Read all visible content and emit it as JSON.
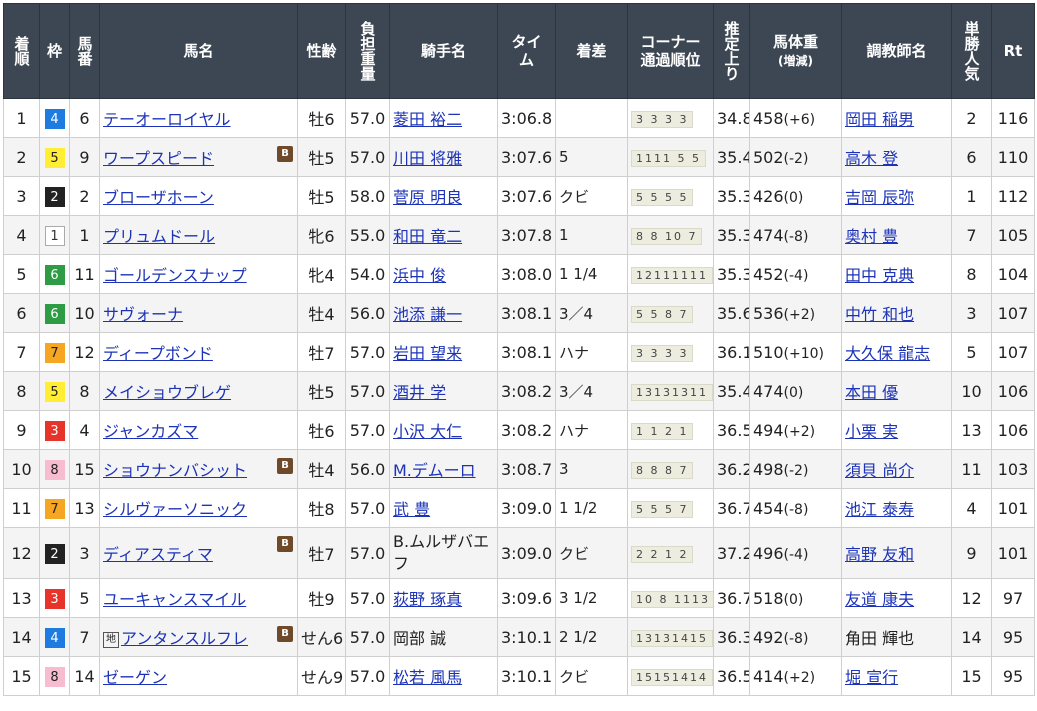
{
  "headers": {
    "rank": "着順",
    "waku": "枠",
    "num": "馬番",
    "horse": "馬名",
    "sexage": "性齢",
    "weight": "負担重量",
    "jockey": "騎手名",
    "time": "タイム",
    "margin": "着差",
    "corner": "コーナー通過順位",
    "last3f": "推定上り",
    "body": "馬体重",
    "body_sub": "(増減)",
    "trainer": "調教師名",
    "pop": "単勝人気",
    "rt": "Rt"
  },
  "blinker_label": "B",
  "rows": [
    {
      "rank": "1",
      "waku": "4",
      "num": "6",
      "horse": "テーオーロイヤル",
      "b": false,
      "sexage": "牡6",
      "weight": "57.0",
      "jockey": "菱田 裕二",
      "jlink": true,
      "time": "3:06.8",
      "margin": "",
      "corner": "3 3 3 3",
      "last3f": "34.8",
      "body": "458",
      "diff": "(+6)",
      "trainer": "岡田 稲男",
      "tlink": true,
      "pop": "2",
      "rt": "116"
    },
    {
      "rank": "2",
      "waku": "5",
      "num": "9",
      "horse": "ワープスピード",
      "b": true,
      "sexage": "牡5",
      "weight": "57.0",
      "jockey": "川田 将雅",
      "jlink": true,
      "time": "3:07.6",
      "margin": "5",
      "corner": "1111 5 5",
      "last3f": "35.4",
      "body": "502",
      "diff": "(-2)",
      "trainer": "高木 登",
      "tlink": true,
      "pop": "6",
      "rt": "110"
    },
    {
      "rank": "3",
      "waku": "2",
      "num": "2",
      "horse": "ブローザホーン",
      "b": false,
      "sexage": "牡5",
      "weight": "58.0",
      "jockey": "菅原 明良",
      "jlink": true,
      "time": "3:07.6",
      "margin": "クビ",
      "corner": "5 5 5 5",
      "last3f": "35.3",
      "body": "426",
      "diff": "(0)",
      "trainer": "吉岡 辰弥",
      "tlink": true,
      "pop": "1",
      "rt": "112"
    },
    {
      "rank": "4",
      "waku": "1",
      "num": "1",
      "horse": "プリュムドール",
      "b": false,
      "sexage": "牝6",
      "weight": "55.0",
      "jockey": "和田 竜二",
      "jlink": true,
      "time": "3:07.8",
      "margin": "1",
      "corner": "8 8 10 7",
      "last3f": "35.3",
      "body": "474",
      "diff": "(-8)",
      "trainer": "奥村 豊",
      "tlink": true,
      "pop": "7",
      "rt": "105"
    },
    {
      "rank": "5",
      "waku": "6",
      "num": "11",
      "horse": "ゴールデンスナップ",
      "b": false,
      "sexage": "牝4",
      "weight": "54.0",
      "jockey": "浜中 俊",
      "jlink": true,
      "time": "3:08.0",
      "margin": "1 1/4",
      "corner": "12111111",
      "last3f": "35.3",
      "body": "452",
      "diff": "(-4)",
      "trainer": "田中 克典",
      "tlink": true,
      "pop": "8",
      "rt": "104"
    },
    {
      "rank": "6",
      "waku": "6",
      "num": "10",
      "horse": "サヴォーナ",
      "b": false,
      "sexage": "牡4",
      "weight": "56.0",
      "jockey": "池添 謙一",
      "jlink": true,
      "time": "3:08.1",
      "margin": "3／4",
      "corner": "5 5 8 7",
      "last3f": "35.6",
      "body": "536",
      "diff": "(+2)",
      "trainer": "中竹 和也",
      "tlink": true,
      "pop": "3",
      "rt": "107"
    },
    {
      "rank": "7",
      "waku": "7",
      "num": "12",
      "horse": "ディープボンド",
      "b": false,
      "sexage": "牡7",
      "weight": "57.0",
      "jockey": "岩田 望来",
      "jlink": true,
      "time": "3:08.1",
      "margin": "ハナ",
      "corner": "3 3 3 3",
      "last3f": "36.1",
      "body": "510",
      "diff": "(+10)",
      "trainer": "大久保 龍志",
      "tlink": true,
      "pop": "5",
      "rt": "107"
    },
    {
      "rank": "8",
      "waku": "5",
      "num": "8",
      "horse": "メイショウブレゲ",
      "b": false,
      "sexage": "牡5",
      "weight": "57.0",
      "jockey": "酒井 学",
      "jlink": true,
      "time": "3:08.2",
      "margin": "3／4",
      "corner": "13131311",
      "last3f": "35.4",
      "body": "474",
      "diff": "(0)",
      "trainer": "本田 優",
      "tlink": true,
      "pop": "10",
      "rt": "106"
    },
    {
      "rank": "9",
      "waku": "3",
      "num": "4",
      "horse": "ジャンカズマ",
      "b": false,
      "sexage": "牡6",
      "weight": "57.0",
      "jockey": "小沢 大仁",
      "jlink": true,
      "time": "3:08.2",
      "margin": "ハナ",
      "corner": "1 1 2 1",
      "last3f": "36.5",
      "body": "494",
      "diff": "(+2)",
      "trainer": "小栗 実",
      "tlink": true,
      "pop": "13",
      "rt": "106"
    },
    {
      "rank": "10",
      "waku": "8",
      "num": "15",
      "horse": "ショウナンバシット",
      "b": true,
      "sexage": "牡4",
      "weight": "56.0",
      "jockey": "M.デムーロ",
      "jlink": true,
      "time": "3:08.7",
      "margin": "3",
      "corner": "8 8 8 7",
      "last3f": "36.2",
      "body": "498",
      "diff": "(-2)",
      "trainer": "須貝 尚介",
      "tlink": true,
      "pop": "11",
      "rt": "103"
    },
    {
      "rank": "11",
      "waku": "7",
      "num": "13",
      "horse": "シルヴァーソニック",
      "b": false,
      "sexage": "牡8",
      "weight": "57.0",
      "jockey": "武 豊",
      "jlink": true,
      "time": "3:09.0",
      "margin": "1 1/2",
      "corner": "5 5 5 7",
      "last3f": "36.7",
      "body": "454",
      "diff": "(-8)",
      "trainer": "池江 泰寿",
      "tlink": true,
      "pop": "4",
      "rt": "101"
    },
    {
      "rank": "12",
      "waku": "2",
      "num": "3",
      "horse": "ディアスティマ",
      "b": true,
      "sexage": "牡7",
      "weight": "57.0",
      "jockey": "B.ムルザバエフ",
      "jlink": false,
      "time": "3:09.0",
      "margin": "クビ",
      "corner": "2 2 1 2",
      "last3f": "37.2",
      "body": "496",
      "diff": "(-4)",
      "trainer": "高野 友和",
      "tlink": true,
      "pop": "9",
      "rt": "101",
      "tall": true
    },
    {
      "rank": "13",
      "waku": "3",
      "num": "5",
      "horse": "ユーキャンスマイル",
      "b": false,
      "sexage": "牡9",
      "weight": "57.0",
      "jockey": "荻野 琢真",
      "jlink": true,
      "time": "3:09.6",
      "margin": "3 1/2",
      "corner": "10 8 1113",
      "last3f": "36.7",
      "body": "518",
      "diff": "(0)",
      "trainer": "友道 康夫",
      "tlink": true,
      "pop": "12",
      "rt": "97"
    },
    {
      "rank": "14",
      "waku": "4",
      "num": "7",
      "horse": "アンタンスルフレ",
      "mark": "地",
      "b": true,
      "sexage": "せん6",
      "weight": "57.0",
      "jockey": "岡部 誠",
      "jlink": false,
      "time": "3:10.1",
      "margin": "2 1/2",
      "corner": "13131415",
      "last3f": "36.3",
      "body": "492",
      "diff": "(-8)",
      "trainer": "角田 輝也",
      "tlink": false,
      "pop": "14",
      "rt": "95"
    },
    {
      "rank": "15",
      "waku": "8",
      "num": "14",
      "horse": "ゼーゲン",
      "b": false,
      "sexage": "せん9",
      "weight": "57.0",
      "jockey": "松若 風馬",
      "jlink": true,
      "time": "3:10.1",
      "margin": "クビ",
      "corner": "15151414",
      "last3f": "36.5",
      "body": "414",
      "diff": "(+2)",
      "trainer": "堀 宣行",
      "tlink": true,
      "pop": "15",
      "rt": "95"
    }
  ]
}
